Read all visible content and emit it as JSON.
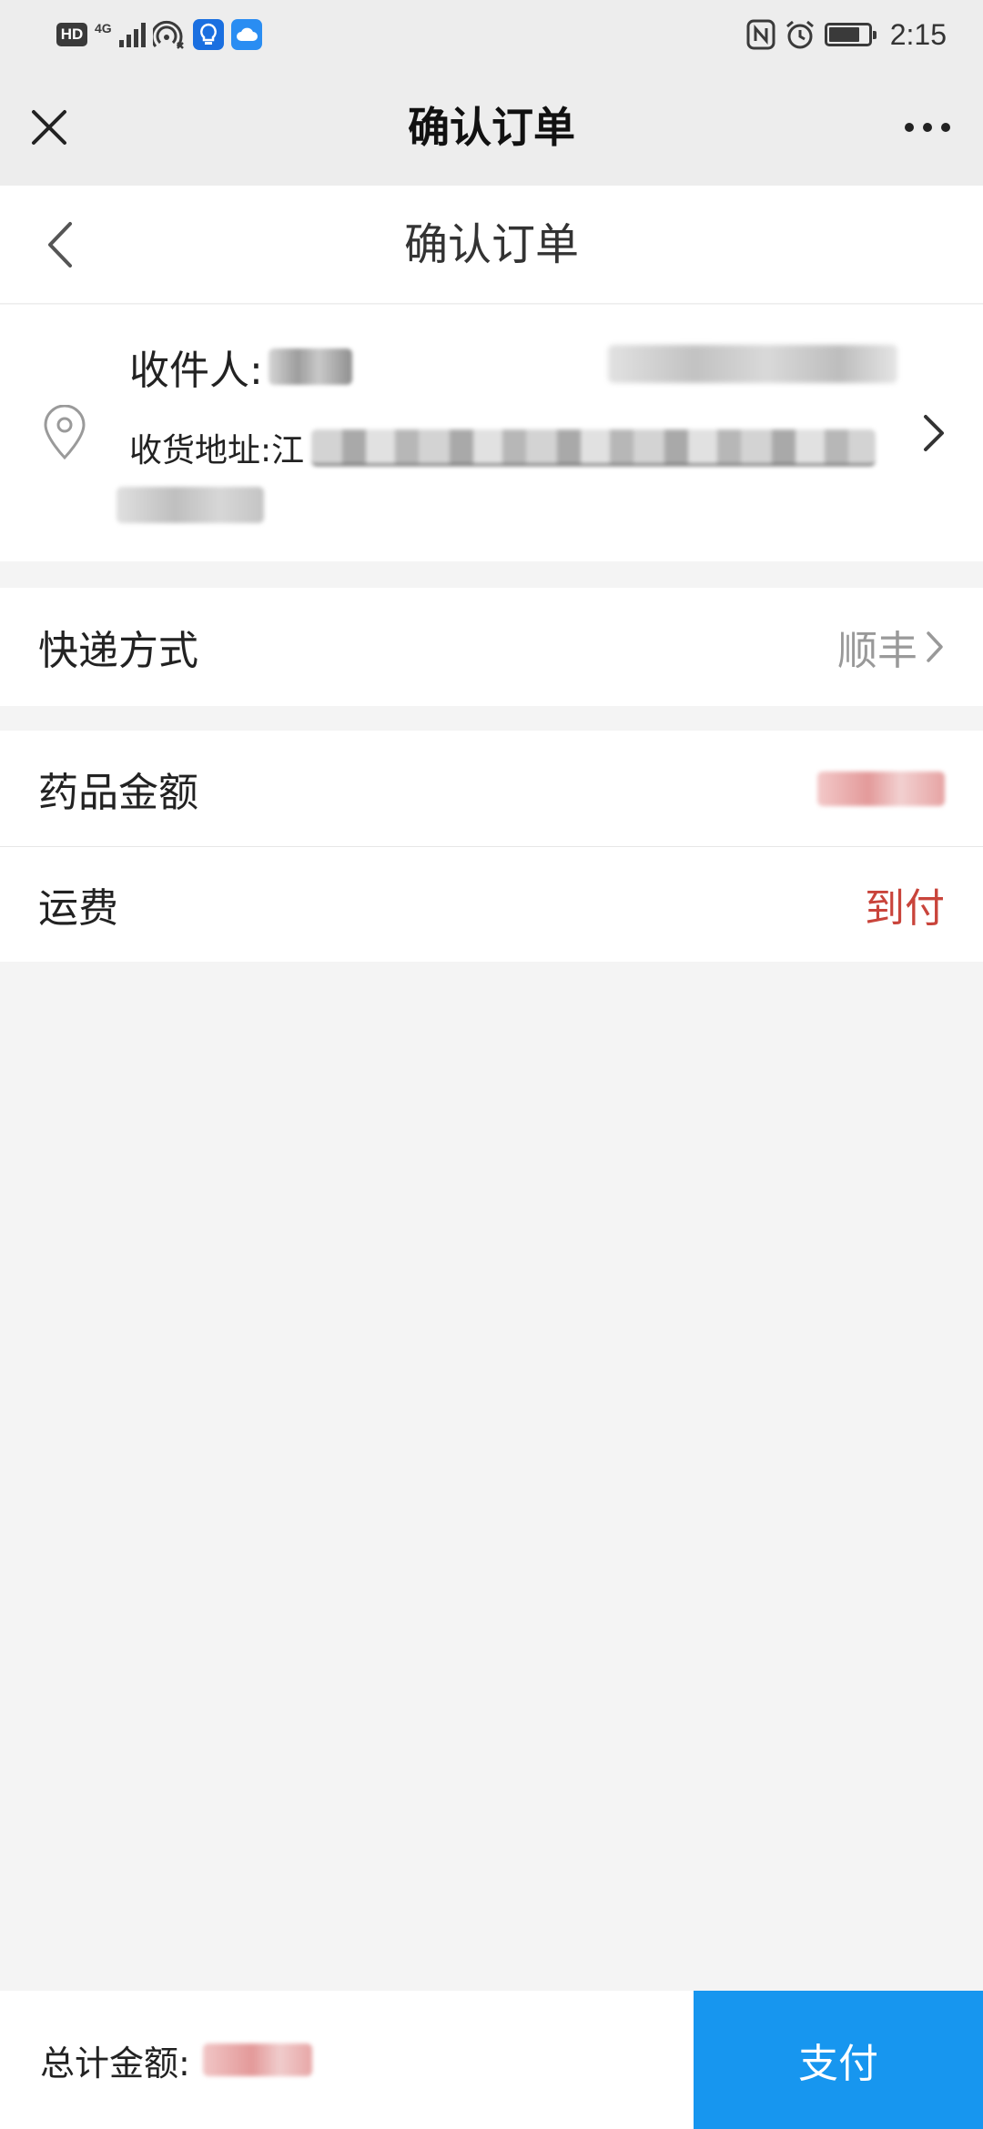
{
  "status_bar": {
    "hd": "HD",
    "network": "4G",
    "time": "2:15",
    "icons": [
      "signal-icon",
      "wifi-hotspot-icon",
      "lightbulb-app-icon",
      "cloud-app-icon",
      "nfc-icon",
      "alarm-icon",
      "battery-icon"
    ]
  },
  "top_bar": {
    "title": "确认订单",
    "close_icon": "close-icon",
    "more_icon": "more-horizontal-icon"
  },
  "page_header": {
    "title": "确认订单",
    "back_icon": "chevron-left-icon"
  },
  "address": {
    "recipient_label": "收件人: ",
    "address_label": "收货地址: ",
    "address_prefix": "江",
    "pin_icon": "location-pin-icon",
    "arrow_icon": "chevron-right-icon"
  },
  "shipping": {
    "label": "快递方式",
    "value": "顺丰"
  },
  "medicine": {
    "label": "药品金额"
  },
  "freight": {
    "label": "运费",
    "value": "到付"
  },
  "bottom": {
    "total_label": "总计金额:",
    "pay_label": "支付"
  },
  "colors": {
    "accent": "#1796ef",
    "price_red": "#c9443b",
    "topbar_bg": "#ededed",
    "page_bg": "#f4f4f4"
  }
}
